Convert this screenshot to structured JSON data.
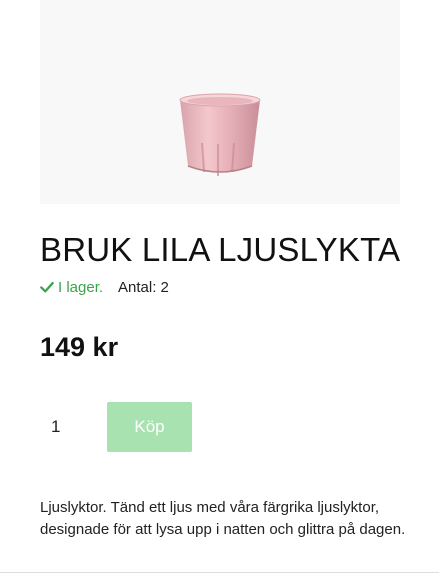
{
  "product": {
    "title": "BRUK LILA LJUSLYKTA",
    "stock_status": "I lager.",
    "quantity_available": "Antal: 2",
    "price": "149 kr",
    "image_icon": "tealight-holder-image"
  },
  "purchase": {
    "quantity_value": "1",
    "buy_label": "Köp"
  },
  "description": {
    "text": "Ljuslyktor. Tänd ett ljus med våra färgrika ljuslyktor, designade för att lysa upp i natten och glittra på dagen."
  },
  "colors": {
    "in_stock": "#3aa34a",
    "buy_button_bg": "#a8e2b0",
    "image_bg": "#f8f8f8"
  }
}
